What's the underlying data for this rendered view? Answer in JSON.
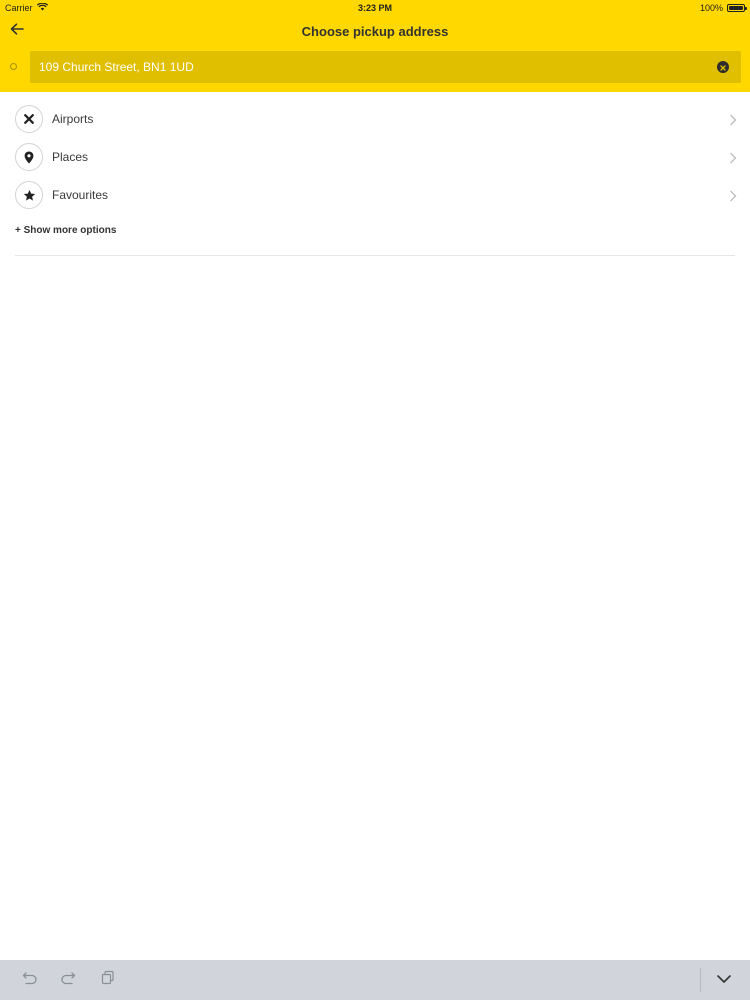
{
  "status_bar": {
    "carrier": "Carrier",
    "time": "3:23 PM",
    "battery": "100%"
  },
  "header": {
    "title": "Choose pickup address",
    "back_icon": "arrow-left-icon"
  },
  "search": {
    "value": "109 Church Street, BN1 1UD",
    "clear_icon": "clear-circle-icon"
  },
  "options": [
    {
      "label": "Airports",
      "icon": "airplane-icon"
    },
    {
      "label": "Places",
      "icon": "map-pin-icon"
    },
    {
      "label": "Favourites",
      "icon": "star-icon"
    }
  ],
  "more_options_label": "+ Show more options",
  "colors": {
    "accent": "#FFD800",
    "search_field": "#E0BE00",
    "bottom_bar": "#D1D5DB"
  }
}
